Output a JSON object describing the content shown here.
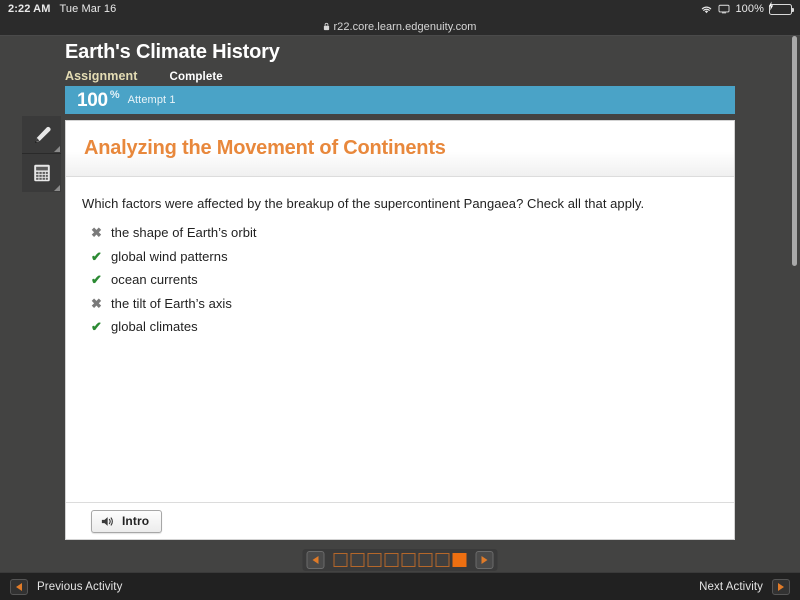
{
  "statusbar": {
    "time": "2:22 AM",
    "date": "Tue Mar 16",
    "battery_percent": "100%",
    "wifi_icon": "wifi-icon",
    "screen_mirror_icon": "screen-icon",
    "battery_icon": "battery-charging-icon"
  },
  "browser": {
    "url": "r22.core.learn.edgenuity.com",
    "lock_icon": "lock-icon"
  },
  "lesson": {
    "title": "Earth's Climate History",
    "type": "Assignment",
    "status": "Complete",
    "score": "100",
    "score_unit": "%",
    "attempt": "Attempt 1",
    "score_color": "#4aa3c7"
  },
  "tools": [
    {
      "name": "highlighter-tool",
      "icon": "pencil-icon"
    },
    {
      "name": "calculator-tool",
      "icon": "calculator-icon"
    }
  ],
  "card": {
    "title": "Analyzing the Movement of Continents",
    "title_color": "#e8883c",
    "question": "Which factors were affected by the breakup of the supercontinent Pangaea? Check all that apply.",
    "choices": [
      {
        "text": "the shape of Earth’s orbit",
        "mark": "✖",
        "state": "wrong"
      },
      {
        "text": "global wind patterns",
        "mark": "✔",
        "state": "correct"
      },
      {
        "text": "ocean currents",
        "mark": "✔",
        "state": "correct"
      },
      {
        "text": "the tilt of Earth’s axis",
        "mark": "✖",
        "state": "wrong"
      },
      {
        "text": "global climates",
        "mark": "✔",
        "state": "correct"
      }
    ],
    "audio_button": {
      "label": "Intro",
      "icon": "speaker-icon"
    }
  },
  "pager": {
    "prev_icon": "chevron-left-icon",
    "next_icon": "chevron-right-icon",
    "total": 8,
    "active_index": 7,
    "active_color": "#ed6f11"
  },
  "activity_bar": {
    "previous_label": "Previous Activity",
    "next_label": "Next Activity",
    "previous_icon": "arrow-left-icon",
    "next_icon": "arrow-right-icon"
  }
}
